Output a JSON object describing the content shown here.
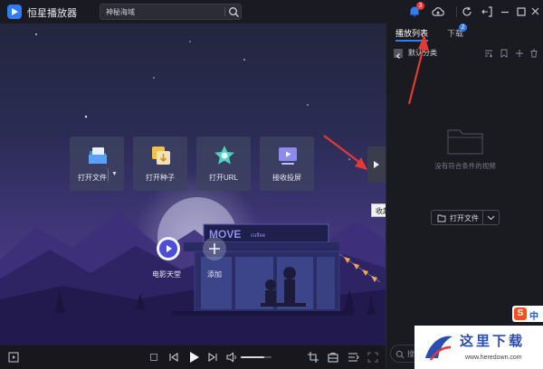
{
  "app": {
    "name": "恒星播放器",
    "name_caret": "⌄"
  },
  "search": {
    "value": "神秘海域",
    "button_icon": "search-icon"
  },
  "titlebar_icons": [
    "notification-icon",
    "cloud-upload-icon",
    "refresh-icon",
    "mini-mode-icon",
    "minimize-icon",
    "maximize-icon",
    "close-icon"
  ],
  "notification_count": "3",
  "quick_actions": [
    {
      "label": "打开文件",
      "icon": "open-file-icon",
      "has_dropdown": true
    },
    {
      "label": "打开种子",
      "icon": "torrent-icon"
    },
    {
      "label": "打开URL",
      "icon": "url-icon"
    },
    {
      "label": "接收投屏",
      "icon": "screen-cast-icon"
    }
  ],
  "shortcuts": [
    {
      "label": "电影天堂",
      "icon": "play-icon"
    },
    {
      "label": "添加",
      "icon": "plus-icon"
    }
  ],
  "scene": {
    "sign_text": "MOVE",
    "sign_subtext": "coffee"
  },
  "collapse_tooltip": "收起列表栏",
  "controls": {
    "left_icon": "playlist-toggle-icon",
    "center_icons": [
      "stop-icon",
      "previous-icon",
      "play-icon",
      "next-icon",
      "volume-icon"
    ],
    "volume_level": 0.75,
    "right_icons": [
      "screenshot-icon",
      "toolbox-icon",
      "subtitle-icon",
      "fullscreen-icon"
    ]
  },
  "panel": {
    "tabs": [
      {
        "label": "播放列表",
        "active": true
      },
      {
        "label": "下载",
        "badge": "2"
      }
    ],
    "category": "默认分类",
    "category_icons": [
      "sort-icon",
      "mark-icon",
      "add-icon",
      "delete-icon"
    ],
    "empty_text": "没有符合条件的视频",
    "open_file_button": "打开文件",
    "search_label": "搜索"
  },
  "watermark": {
    "title": "这里下载",
    "url": "www.heredown.com"
  },
  "sogou": {
    "badge": "S",
    "text": "中"
  },
  "colors": {
    "accent": "#2f7cf6",
    "badge_red": "#e53935",
    "annotation": "#e53935"
  }
}
